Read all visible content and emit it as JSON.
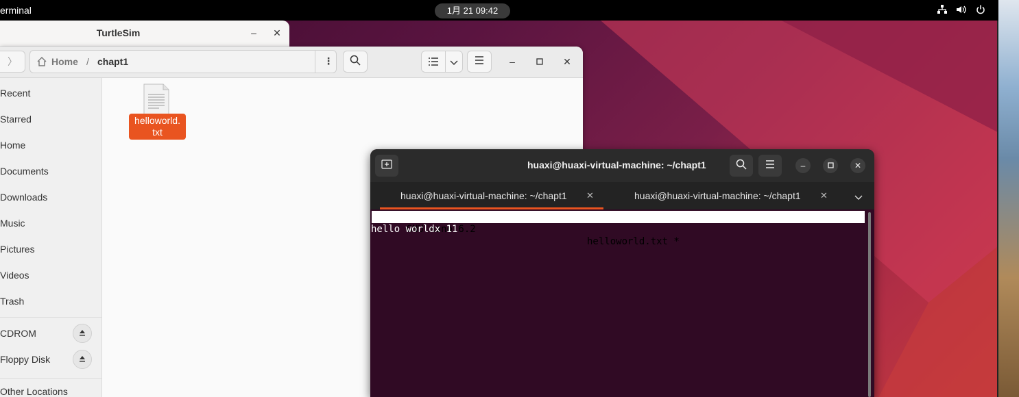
{
  "topbar": {
    "app_name": "erminal",
    "clock": "1月 21  09:42",
    "tray_icons": [
      "network-icon",
      "volume-icon",
      "power-icon"
    ]
  },
  "turtlesim": {
    "title": "TurtleSim",
    "minimize": "–",
    "close": "✕"
  },
  "files": {
    "breadcrumb": {
      "home": "Home",
      "separator": "/",
      "current": "chapt1"
    },
    "sidebar": {
      "items": [
        "Recent",
        "Starred",
        "Home",
        "Documents",
        "Downloads",
        "Music",
        "Pictures",
        "Videos",
        "Trash"
      ],
      "devices": [
        "CDROM",
        "Floppy Disk"
      ],
      "other": "Other Locations"
    },
    "file": {
      "name_line1": "helloworld.",
      "name_line2": "txt"
    }
  },
  "terminal": {
    "title": "huaxi@huaxi-virtual-machine: ~/chapt1",
    "tabs": [
      {
        "label": "huaxi@huaxi-virtual-machine: ~/chapt1",
        "active": true
      },
      {
        "label": "huaxi@huaxi-virtual-machine: ~/chapt1",
        "active": false
      }
    ],
    "nano_header_left": "  GNU nano 6.2",
    "nano_header_right": "helloworld.txt *",
    "content": "hello worldx 11"
  },
  "colors": {
    "accent": "#e95420",
    "terminal_bg": "#300a24"
  }
}
